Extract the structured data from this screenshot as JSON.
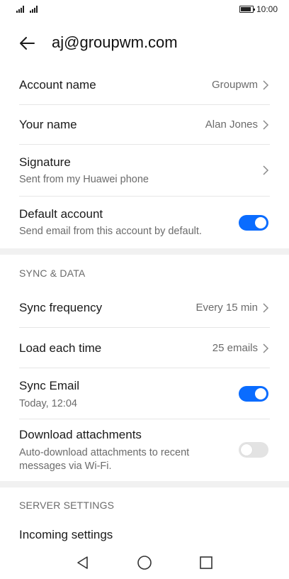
{
  "status_bar": {
    "time": "10:00",
    "battery_level": 0.9
  },
  "header": {
    "title": "aj@groupwm.com",
    "back_icon": "arrow-left-icon"
  },
  "account": {
    "account_name": {
      "title": "Account name",
      "value": "Groupwm"
    },
    "your_name": {
      "title": "Your name",
      "value": "Alan Jones"
    },
    "signature": {
      "title": "Signature",
      "subtitle": "Sent from my Huawei phone"
    },
    "default_account": {
      "title": "Default account",
      "subtitle": "Send email from this account by default.",
      "enabled": true
    }
  },
  "sync": {
    "header": "SYNC & DATA",
    "sync_frequency": {
      "title": "Sync frequency",
      "value": "Every 15 min"
    },
    "load_each_time": {
      "title": "Load each time",
      "value": "25 emails"
    },
    "sync_email": {
      "title": "Sync Email",
      "subtitle": "Today, 12:04",
      "enabled": true
    },
    "download_attachments": {
      "title": "Download attachments",
      "subtitle_line1": "Auto-download attachments to recent",
      "subtitle_line2": "messages via Wi-Fi.",
      "enabled": false
    }
  },
  "server": {
    "header": "SERVER SETTINGS",
    "incoming_settings": {
      "title": "Incoming settings"
    }
  },
  "nav_bar": {
    "back": "triangle-back-icon",
    "home": "circle-home-icon",
    "recents": "square-recents-icon"
  },
  "colors": {
    "accent": "#0a6cff",
    "toggle_off": "#e3e3e3",
    "section_gap": "#f1f1f1"
  }
}
